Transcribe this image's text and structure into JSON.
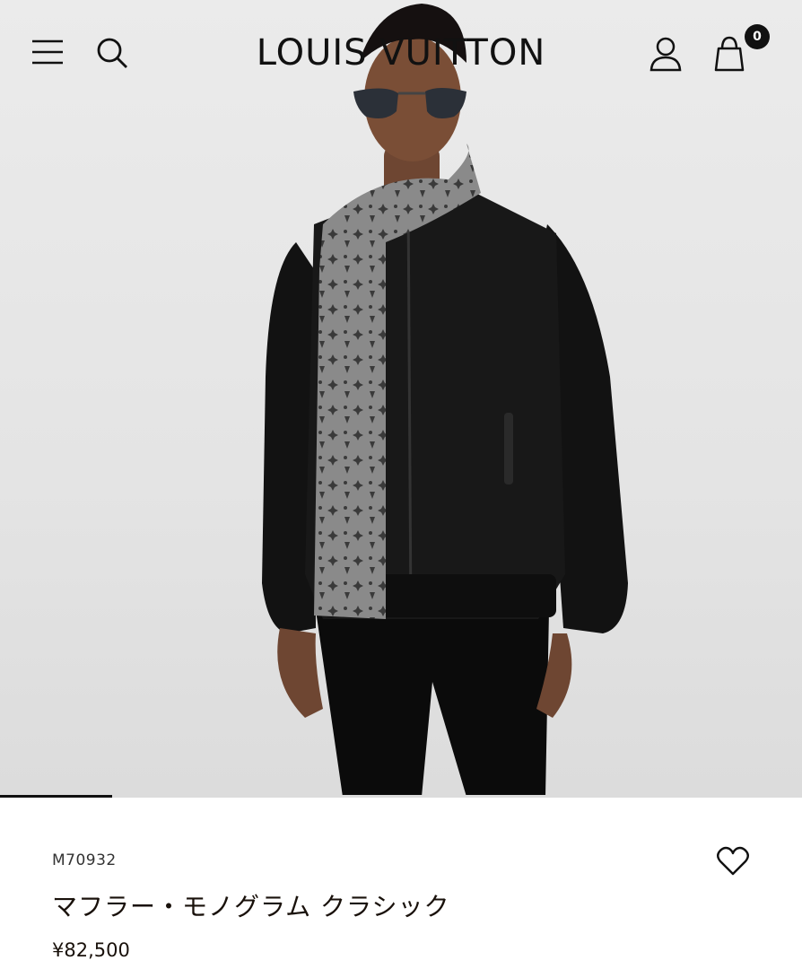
{
  "header": {
    "logo_text": "LOUIS VUITTON",
    "menu_icon": "hamburger-menu-icon",
    "search_icon": "search-icon",
    "account_icon": "user-icon",
    "bag_icon": "shopping-bag-icon",
    "bag_count": "0"
  },
  "gallery": {
    "progress": 0.14
  },
  "product": {
    "sku": "M70932",
    "name": "マフラー・モノグラム クラシック",
    "price": "¥82,500",
    "wishlist_icon": "heart-icon"
  },
  "colors": {
    "text": "#19110b",
    "background": "#ffffff",
    "hero_bg": "#e6e6e6",
    "badge": "#111111"
  }
}
